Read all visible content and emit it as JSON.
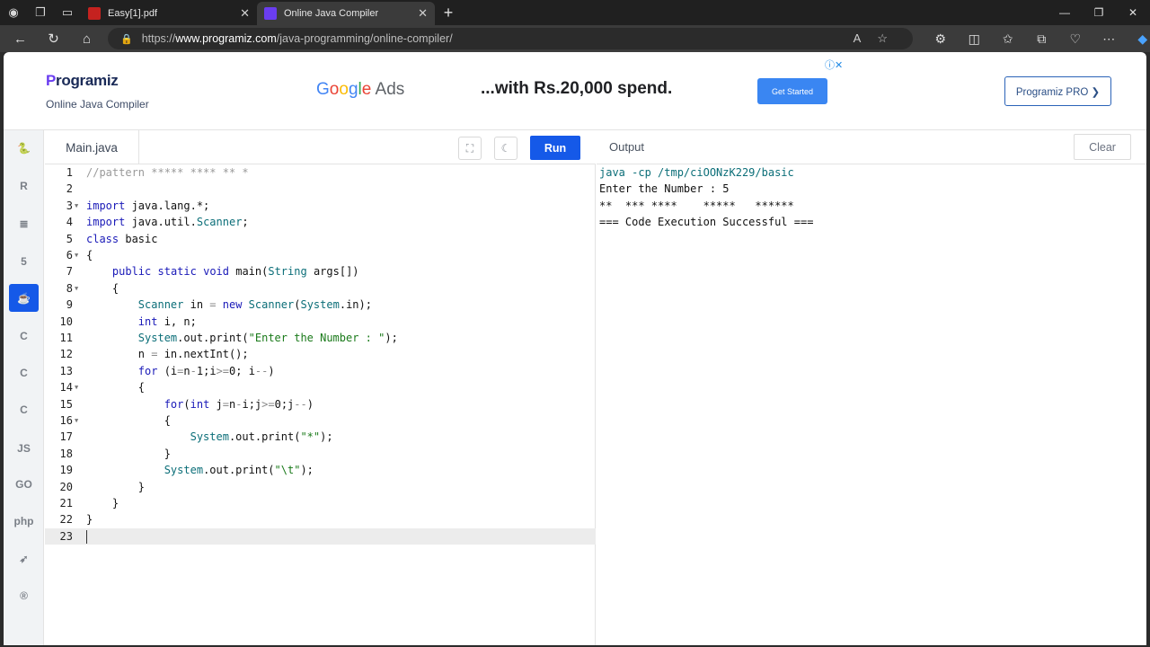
{
  "browser": {
    "tabs": [
      {
        "title": "Easy[1].pdf",
        "active": false
      },
      {
        "title": "Online Java Compiler",
        "active": true
      }
    ],
    "url_prefix": "https://",
    "url_host": "www.programiz.com",
    "url_path": "/java-programming/online-compiler/"
  },
  "header": {
    "logo": "Programiz",
    "logo_letter": "P",
    "logo_rest": "rogramiz",
    "subtitle": "Online Java Compiler",
    "ad_text": "...with Rs.20,000 spend.",
    "ad_button": "Get Started",
    "pro_button": "Programiz PRO ❯"
  },
  "sidebar": {
    "languages": [
      {
        "icon": "python-icon",
        "glyph": "🐍",
        "active": false
      },
      {
        "icon": "r-icon",
        "glyph": "R",
        "active": false
      },
      {
        "icon": "sql-icon",
        "glyph": "≣",
        "active": false
      },
      {
        "icon": "html-icon",
        "glyph": "5",
        "active": false
      },
      {
        "icon": "java-icon",
        "glyph": "☕",
        "active": true
      },
      {
        "icon": "c-icon",
        "glyph": "C",
        "active": false
      },
      {
        "icon": "cpp-icon",
        "glyph": "C",
        "active": false
      },
      {
        "icon": "csharp-icon",
        "glyph": "C",
        "active": false
      },
      {
        "icon": "js-icon",
        "glyph": "JS",
        "active": false
      },
      {
        "icon": "go-icon",
        "glyph": "GO",
        "active": false
      },
      {
        "icon": "php-icon",
        "glyph": "php",
        "active": false
      },
      {
        "icon": "swift-icon",
        "glyph": "➶",
        "active": false
      },
      {
        "icon": "rust-icon",
        "glyph": "®",
        "active": false
      }
    ]
  },
  "editor": {
    "file_tab": "Main.java",
    "run_label": "Run",
    "lines": [
      "//pattern ***** **** ** *",
      "",
      "import java.lang.*;",
      "import java.util.Scanner;",
      "class basic",
      "{",
      "    public static void main(String args[])",
      "    {",
      "        Scanner in = new Scanner(System.in);",
      "        int i, n;",
      "        System.out.print(\"Enter the Number : \");",
      "        n = in.nextInt();",
      "        for (i=n-1;i>=0; i--)",
      "        {",
      "            for(int j=n-i;j>=0;j--)",
      "            {",
      "                System.out.print(\"*\");",
      "            }",
      "            System.out.print(\"\\t\");",
      "        }",
      "    }",
      "}",
      ""
    ]
  },
  "output": {
    "label": "Output",
    "clear_label": "Clear",
    "lines": [
      "java -cp /tmp/ciOONzK229/basic",
      "Enter the Number : 5",
      "**  *** ****    *****   ******",
      "=== Code Execution Successful ==="
    ]
  }
}
